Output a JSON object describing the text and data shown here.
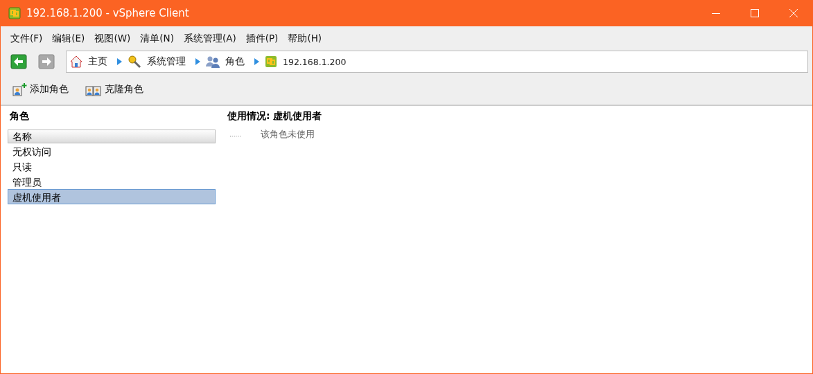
{
  "window": {
    "title": "192.168.1.200 - vSphere Client"
  },
  "menu": [
    "文件(F)",
    "编辑(E)",
    "视图(W)",
    "清单(N)",
    "系统管理(A)",
    "插件(P)",
    "帮助(H)"
  ],
  "nav": {
    "back_disabled": false,
    "forward_disabled": true
  },
  "breadcrumb": [
    {
      "kind": "home",
      "label": "主页"
    },
    {
      "kind": "admin",
      "label": "系统管理"
    },
    {
      "kind": "roles",
      "label": "角色"
    },
    {
      "kind": "host",
      "label": "192.168.1.200"
    }
  ],
  "toolbar": [
    {
      "kind": "add",
      "label": "添加角色"
    },
    {
      "kind": "clone",
      "label": "克隆角色"
    }
  ],
  "roles": {
    "title": "角色",
    "column": "名称",
    "items": [
      {
        "label": "无权访问",
        "selected": false
      },
      {
        "label": "只读",
        "selected": false
      },
      {
        "label": "管理员",
        "selected": false
      },
      {
        "label": "虚机使用者",
        "selected": true
      }
    ]
  },
  "usage": {
    "title": "使用情况: 虚机使用者",
    "marker": "......",
    "message": "该角色未使用"
  }
}
